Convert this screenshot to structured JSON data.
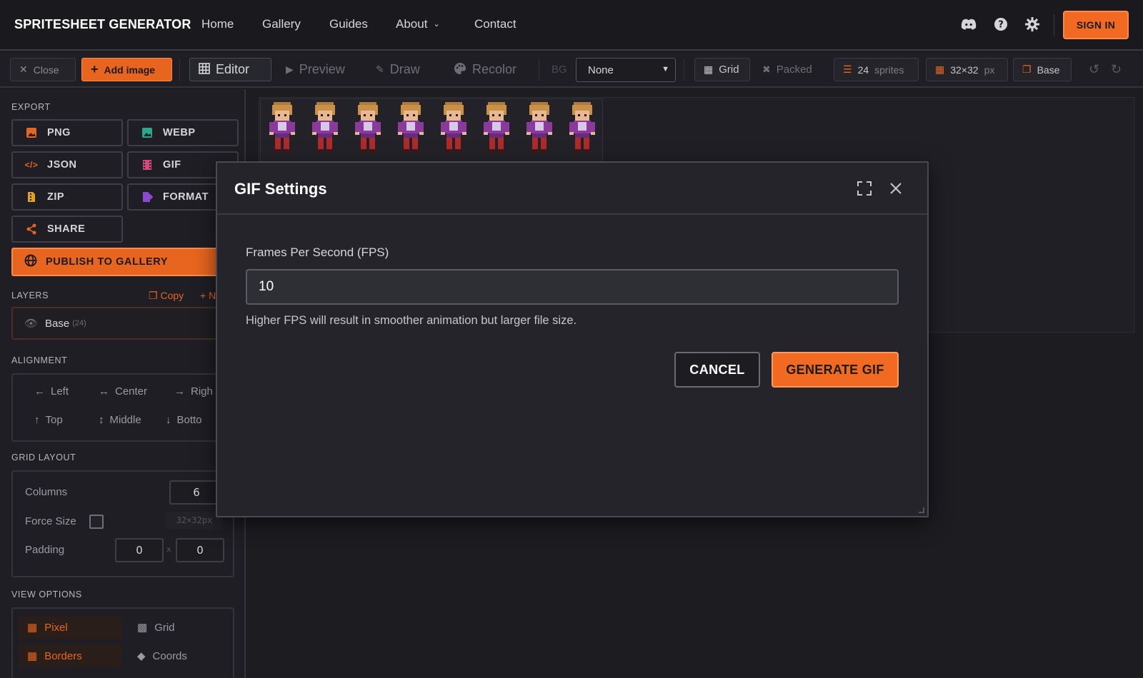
{
  "colors": {
    "accent": "#f26a22",
    "bg": "#1c1c21",
    "panel": "#1e1e24",
    "modal": "#24242a"
  },
  "nav": {
    "brand": "SPRITESHEET GENERATOR",
    "links": [
      "Home",
      "Gallery",
      "Guides",
      "About",
      "Contact"
    ],
    "signin": "SIGN IN"
  },
  "toolbar": {
    "close": "Close",
    "add_image": "Add image",
    "editor": "Editor",
    "preview": "Preview",
    "draw": "Draw",
    "recolor": "Recolor",
    "bg_label": "BG",
    "bg_value": "None",
    "grid": "Grid",
    "packed": "Packed",
    "sprite_count": "24",
    "sprite_unit": "sprites",
    "size": "32×32",
    "size_unit": "px",
    "base": "Base"
  },
  "sidebar": {
    "export_title": "EXPORT",
    "export_buttons": [
      "PNG",
      "WEBP",
      "JSON",
      "GIF",
      "ZIP",
      "FORMAT",
      "SHARE"
    ],
    "publish": "PUBLISH TO GALLERY",
    "layers_title": "LAYERS",
    "layers_copy": "Copy",
    "layers_new": "+ N",
    "layer_name": "Base",
    "layer_count": "(24)",
    "alignment_title": "ALIGNMENT",
    "align": [
      "Left",
      "Center",
      "Righ",
      "Top",
      "Middle",
      "Botto"
    ],
    "grid_title": "GRID LAYOUT",
    "columns_label": "Columns",
    "columns_value": "6",
    "force_size_label": "Force Size",
    "force_size_value": "32×32px",
    "padding_label": "Padding",
    "padding_x": "0",
    "padding_sep": "x",
    "padding_y": "0",
    "view_title": "VIEW OPTIONS",
    "view": [
      "Pixel",
      "Grid",
      "Borders",
      "Coords"
    ]
  },
  "modal": {
    "title": "GIF Settings",
    "fps_label": "Frames Per Second (FPS)",
    "fps_value": "10",
    "help": "Higher FPS will result in smoother animation but larger file size.",
    "cancel": "CANCEL",
    "generate": "GENERATE GIF"
  }
}
